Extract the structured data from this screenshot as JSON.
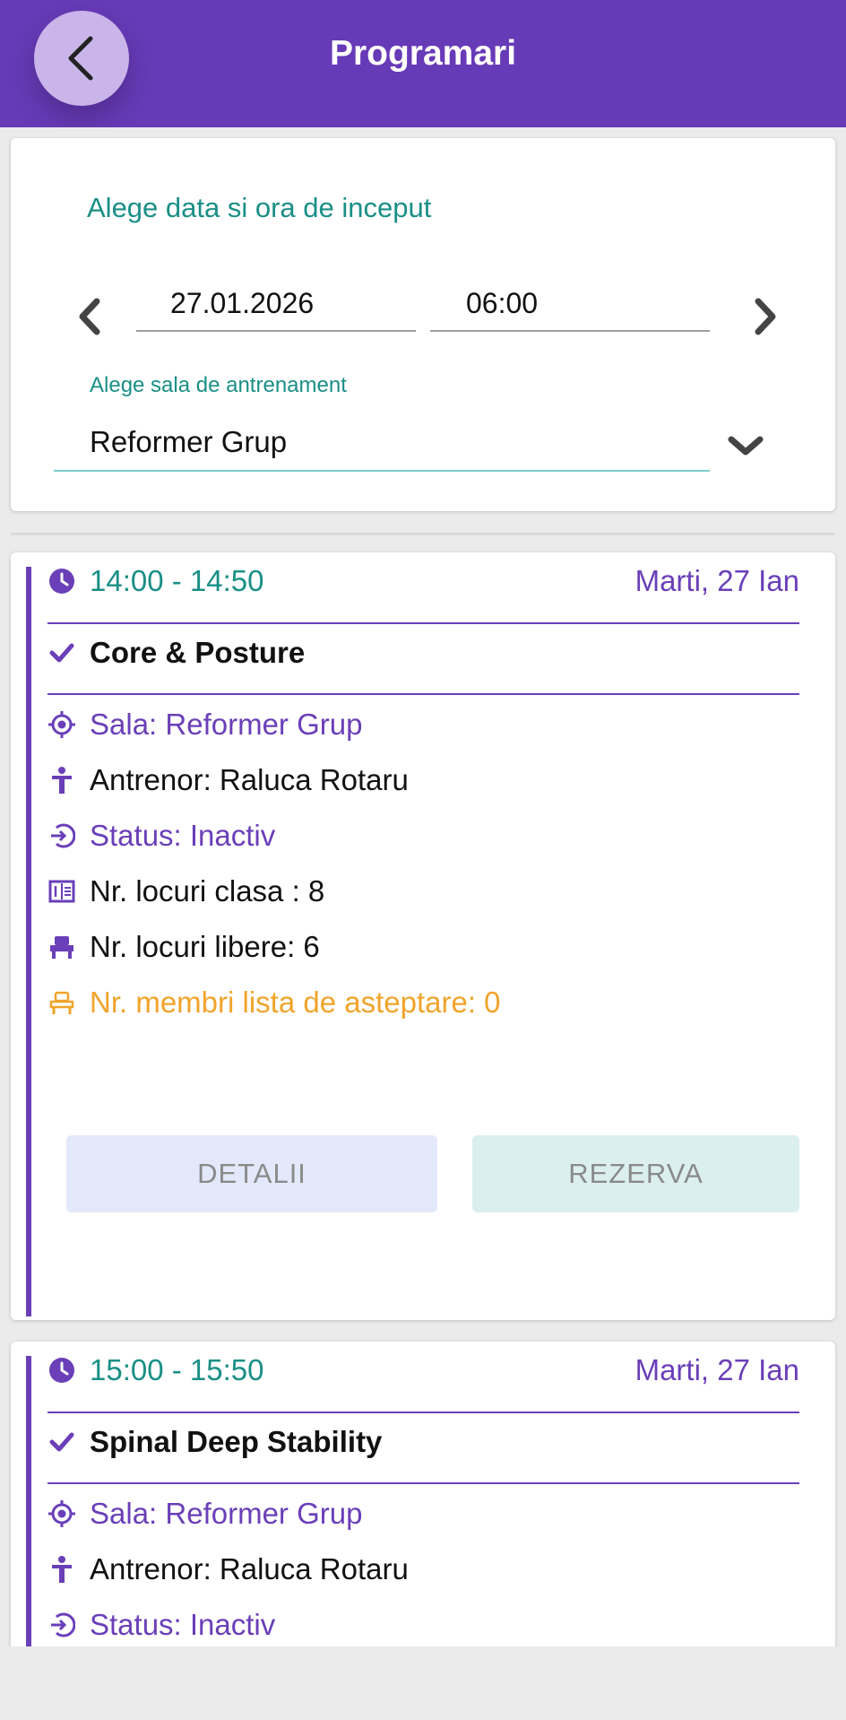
{
  "header": {
    "title": "Programari",
    "back_icon": "chevron-left-icon"
  },
  "filters": {
    "date_time_label": "Alege data si ora de inceput",
    "date": "27.01.2026",
    "time": "06:00",
    "room_label": "Alege sala de antrenament",
    "room": "Reformer Grup"
  },
  "colors": {
    "primary": "#673ab7",
    "accent_teal": "#1a8f86",
    "accent_purple": "#6a3fb8",
    "warning_orange": "#f0a42b"
  },
  "classes": [
    {
      "time": "14:00 - 14:50",
      "date": "Marti, 27 Ian",
      "name": "Core & Posture",
      "room": "Sala: Reformer Grup",
      "trainer": "Antrenor: Raluca Rotaru",
      "status": "Status: Inactiv",
      "capacity": "Nr. locuri clasa : 8",
      "free_spots": "Nr. locuri libere: 6",
      "waitlist": "Nr. membri lista de asteptare: 0",
      "details_label": "DETALII",
      "book_label": "REZERVA"
    },
    {
      "time": "15:00 - 15:50",
      "date": "Marti, 27 Ian",
      "name": "Spinal Deep Stability",
      "room": "Sala: Reformer Grup",
      "trainer": "Antrenor: Raluca Rotaru",
      "status": "Status: Inactiv"
    }
  ]
}
